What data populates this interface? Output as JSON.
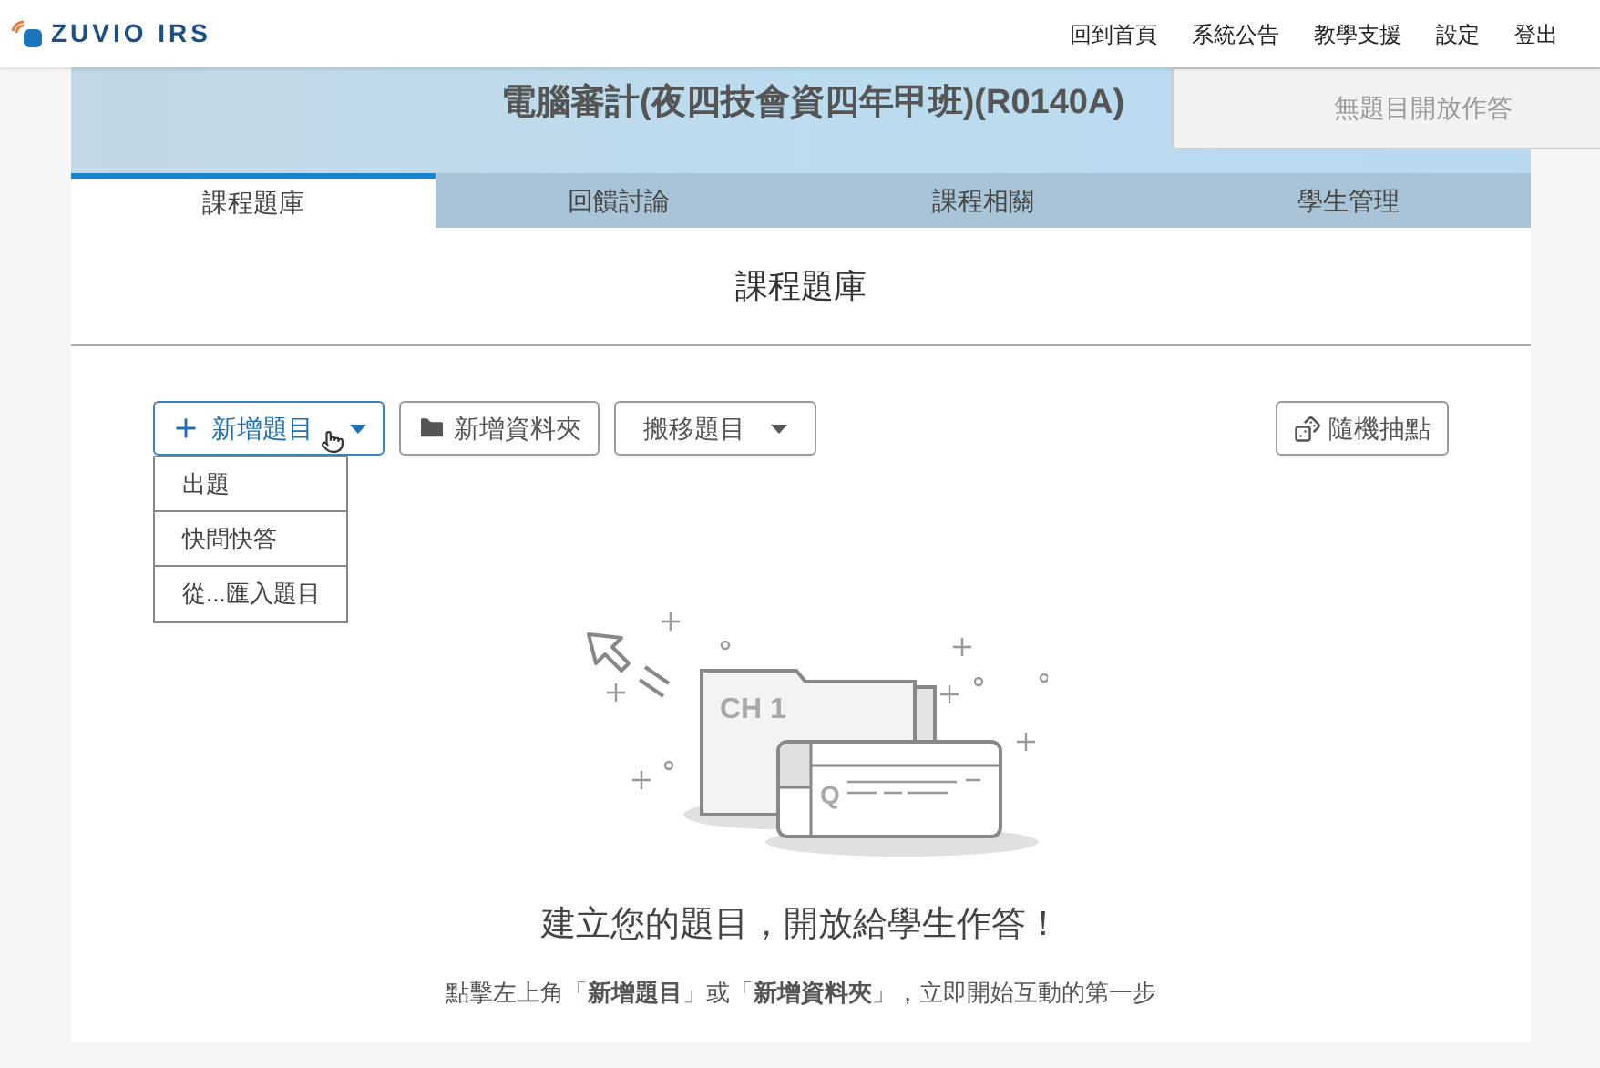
{
  "brand": {
    "name": "ZUVIO IRS"
  },
  "nav": [
    {
      "label": "回到首頁"
    },
    {
      "label": "系統公告"
    },
    {
      "label": "教學支援"
    },
    {
      "label": "設定"
    },
    {
      "label": "登出"
    }
  ],
  "course": {
    "title": "電腦審計(夜四技會資四年甲班)(R0140A)",
    "status": "無題目開放作答"
  },
  "tabs": [
    {
      "label": "課程題庫",
      "selected": true
    },
    {
      "label": "回饋討論",
      "selected": false
    },
    {
      "label": "課程相關",
      "selected": false
    },
    {
      "label": "學生管理",
      "selected": false
    }
  ],
  "section_title": "課程題庫",
  "toolbar": [
    {
      "label": "新增題目",
      "kind": "add",
      "expanded": true
    },
    {
      "label": "新增資料夾",
      "kind": "folder",
      "expanded": false
    },
    {
      "label": "搬移題目",
      "kind": "move",
      "expanded": false
    },
    {
      "label": "隨機抽點",
      "kind": "random",
      "expanded": false
    }
  ],
  "dropdown": [
    {
      "label": "出題"
    },
    {
      "label": "快問快答"
    },
    {
      "label": "從...匯入題目"
    }
  ],
  "illustration": {
    "folder_label": "CH 1",
    "card_label": "Q"
  },
  "empty_state": {
    "title": "建立您的題目，開放給學生作答！",
    "subtitle": "點擊左上角「**新增題目**」或「**新增資料夾**」，立即開始互動的第一步"
  }
}
